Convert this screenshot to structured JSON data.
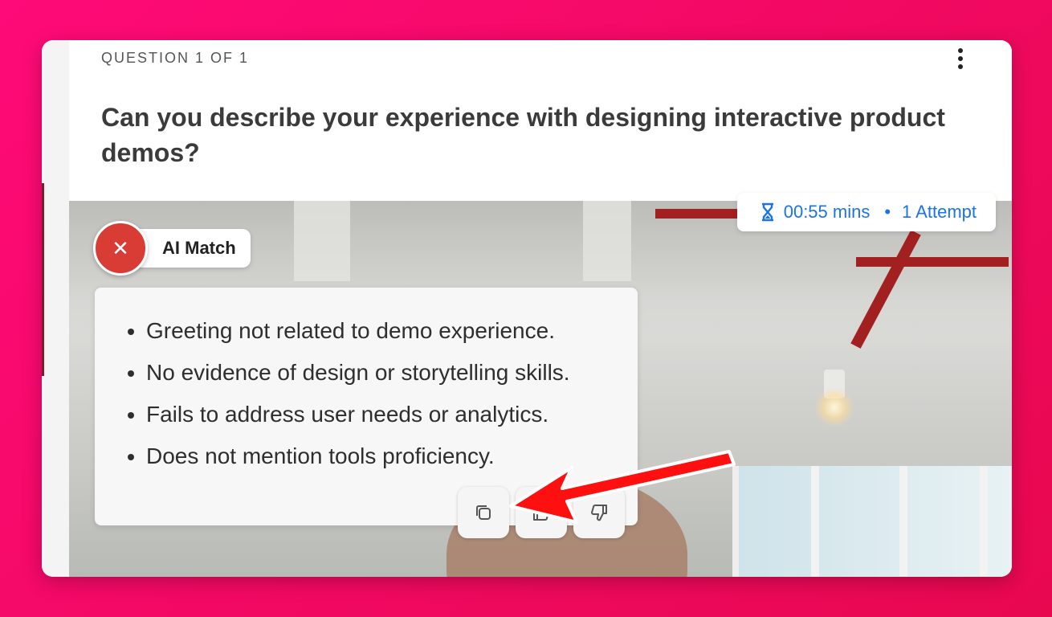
{
  "question": {
    "counter": "QUESTION 1 OF 1",
    "text": "Can you describe your experience with designing interactive product demos?"
  },
  "timer": {
    "duration": "00:55 mins",
    "attempts": "1 Attempt",
    "separator": "•",
    "icon": "hourglass-icon"
  },
  "ai_match": {
    "label": "AI Match",
    "status_icon": "close-icon",
    "status_color": "#d93b35"
  },
  "feedback": {
    "items": [
      "Greeting not related to demo experience.",
      "No evidence of design or storytelling skills.",
      "Fails to address user needs or analytics.",
      "Does not mention tools proficiency."
    ],
    "actions": [
      "copy-icon",
      "thumbs-up-icon",
      "thumbs-down-icon"
    ]
  },
  "colors": {
    "background": "#ff0a78",
    "accent_blue": "#1a73e8",
    "annotation_arrow": "#ff1010"
  }
}
